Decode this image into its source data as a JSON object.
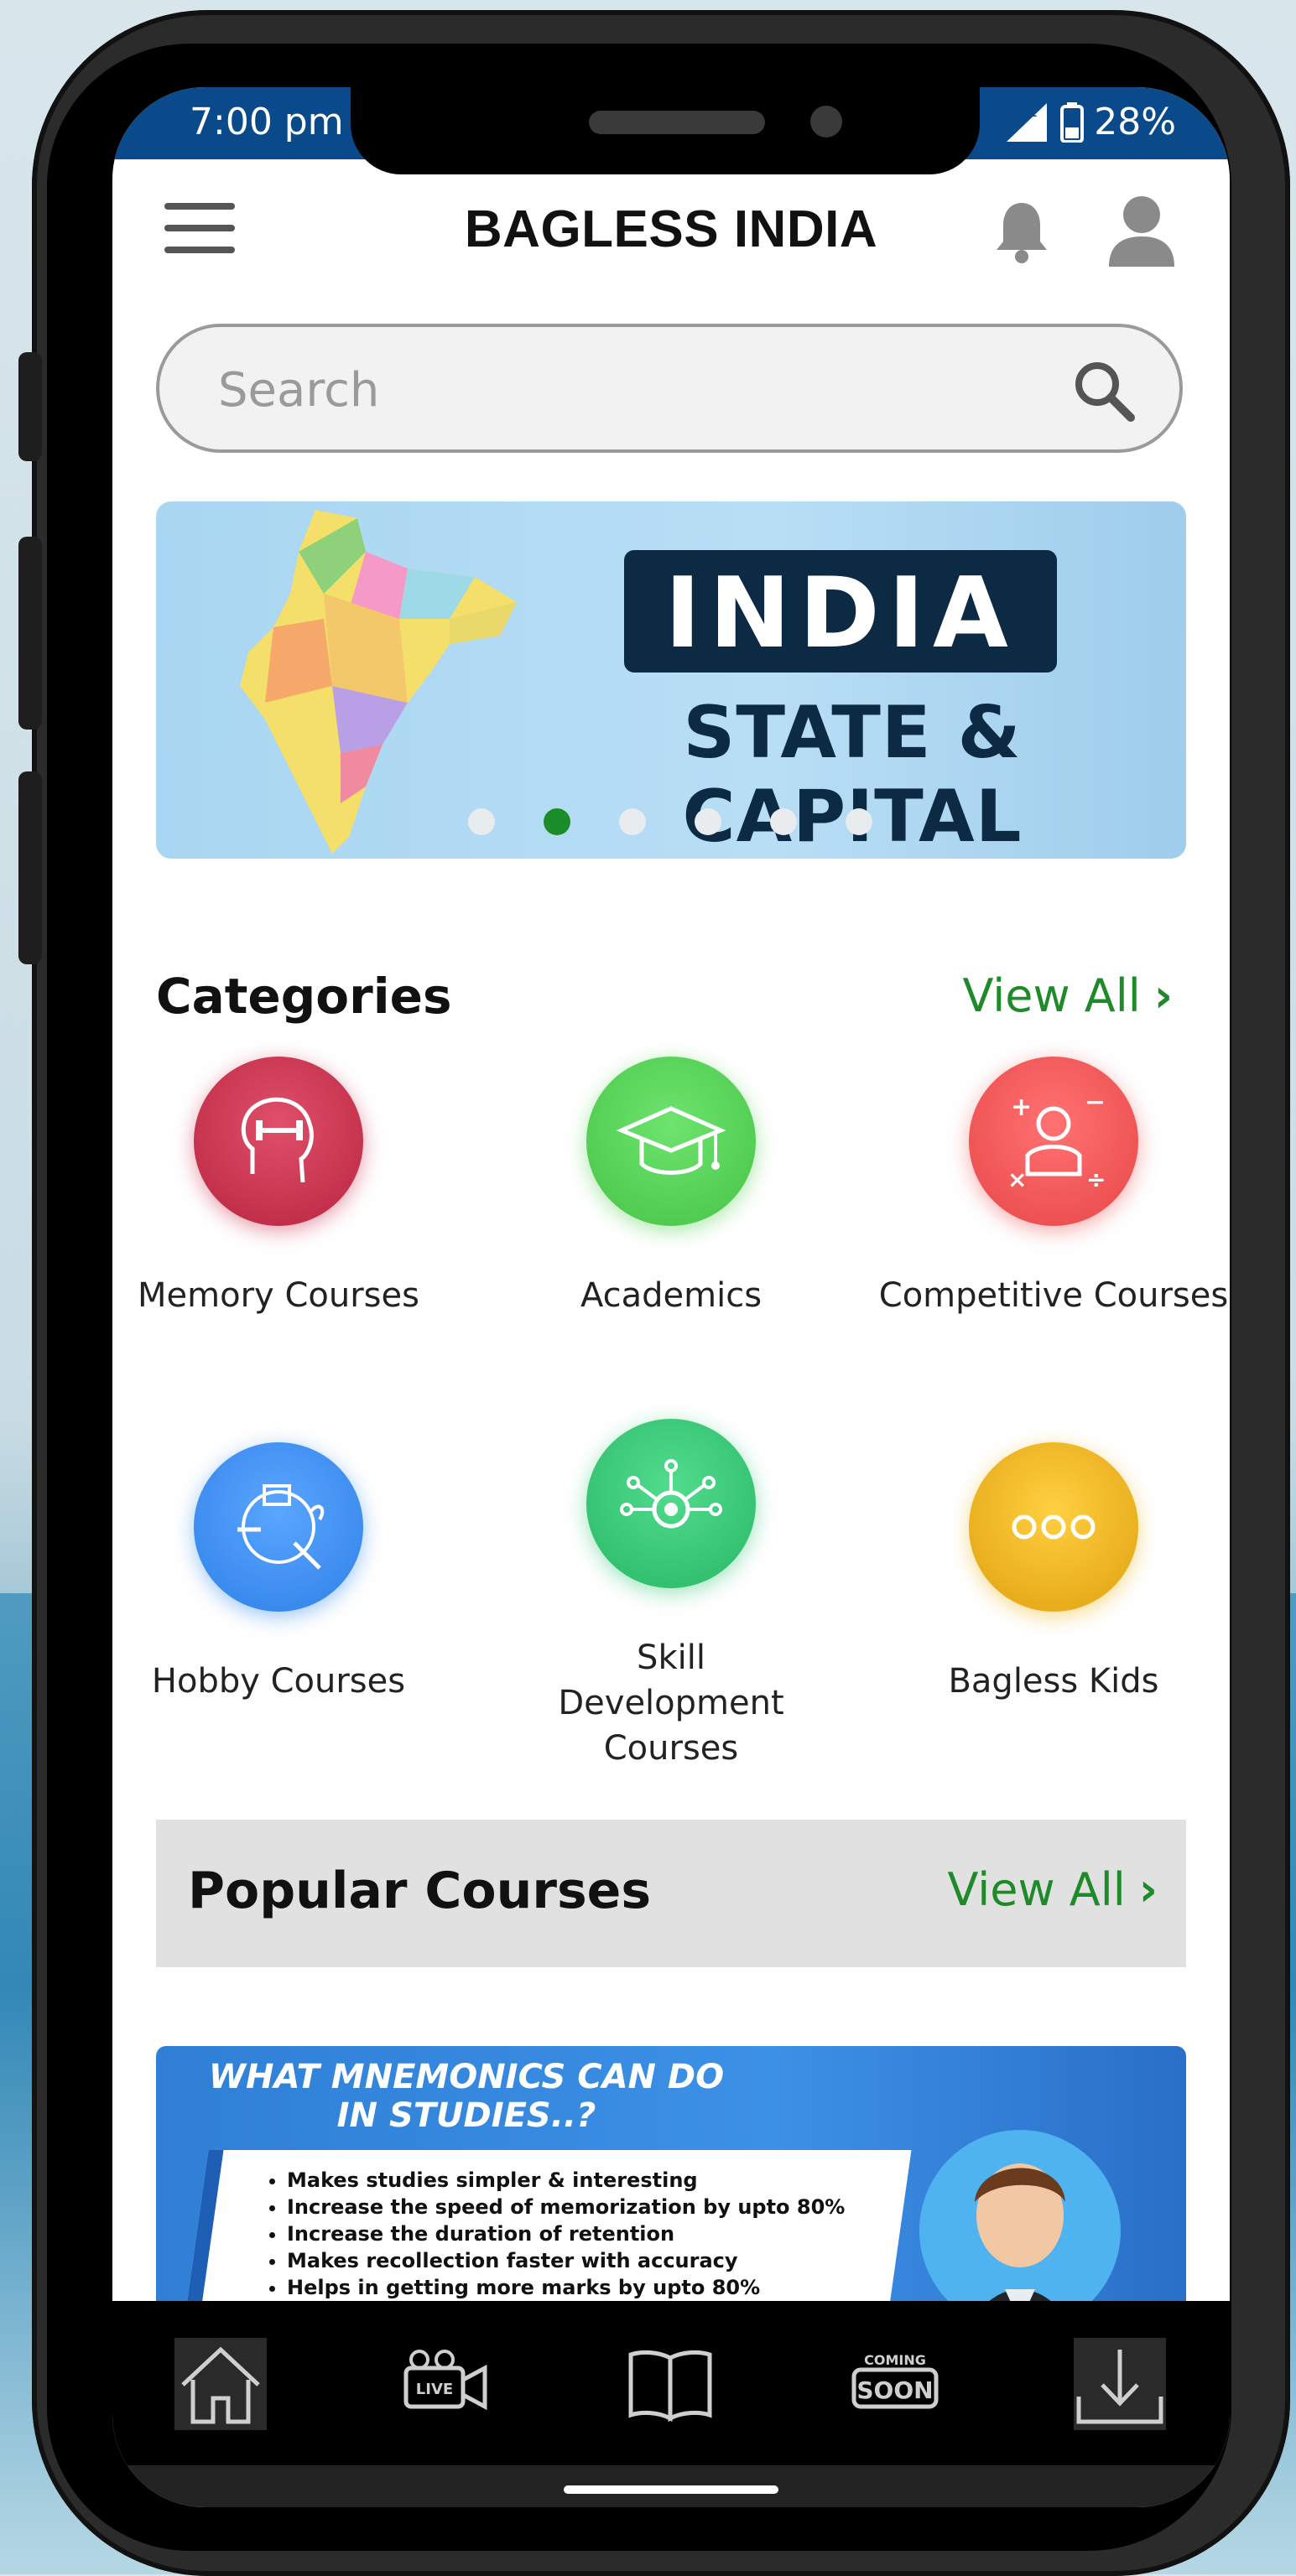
{
  "status_bar": {
    "time": "7:00 pm",
    "signal_label": "2",
    "battery": "28%"
  },
  "header": {
    "title": "BAGLESS INDIA"
  },
  "search": {
    "placeholder": "Search"
  },
  "banner": {
    "headline": "INDIA",
    "subtitle": "STATE & CAPITAL",
    "slide_count": 6,
    "active_slide": 2
  },
  "categories": {
    "title": "Categories",
    "view_all": "View All",
    "items": [
      {
        "label": "Memory Courses",
        "icon": "brain-dumbbell-icon",
        "color": "#d23a55"
      },
      {
        "label": "Academics",
        "icon": "graduation-cap-icon",
        "color": "#5ad45a"
      },
      {
        "label": "Competitive Courses",
        "icon": "student-math-icon",
        "color": "#f25a5a"
      },
      {
        "label": "Hobby Courses",
        "icon": "hobby-tools-icon",
        "color": "#3b8ff2"
      },
      {
        "label": "Skill Development Courses",
        "icon": "gear-network-icon",
        "color": "#3ccc7c"
      },
      {
        "label": "Bagless Kids",
        "icon": "more-dots-icon",
        "color": "#f0b820"
      }
    ]
  },
  "popular": {
    "title": "Popular Courses",
    "view_all": "View All",
    "course_banner": {
      "title": "WHAT MNEMONICS CAN DO IN STUDIES..?",
      "points": [
        "Makes studies simpler & interesting",
        "Increase the speed of memorization by upto 80%",
        "Increase the duration of retention",
        "Makes recollection faster with accuracy",
        "Helps in getting more marks by upto 80%"
      ]
    }
  },
  "bottom_nav": {
    "items": [
      {
        "icon": "home-icon",
        "label": ""
      },
      {
        "icon": "live-camera-icon",
        "label": "LIVE"
      },
      {
        "icon": "book-icon",
        "label": ""
      },
      {
        "icon": "coming-soon-icon",
        "label": "COMING SOON"
      },
      {
        "icon": "download-icon",
        "label": ""
      }
    ]
  },
  "colors": {
    "accent_green": "#1f8a2a",
    "status_bar": "#0b4a8a"
  }
}
